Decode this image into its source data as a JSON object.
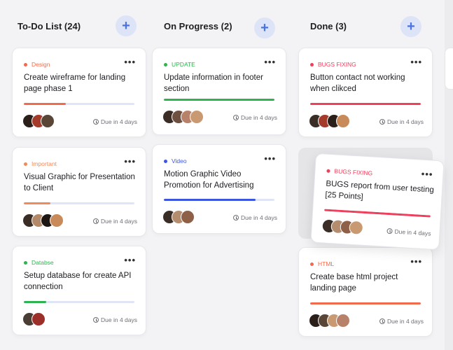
{
  "colors": {
    "design": "#f06a4b",
    "important": "#f08a58",
    "database": "#2fb34f",
    "update": "#2fb34f",
    "video": "#3b55e0",
    "bugs": "#ef3f5b",
    "html": "#f06a4b",
    "add_button": "#dde4f7"
  },
  "columns": [
    {
      "title": "To-Do List (24)",
      "add_icon": "plus-icon",
      "cards": [
        {
          "tag": "Design",
          "tag_color": "#f06a4b",
          "title": "Create wireframe for landing page phase 1",
          "progress": 0.38,
          "bar_color": "#f06a4b",
          "avatars": [
            "#2b1f1a",
            "#a33a2a",
            "#5a4636"
          ],
          "due": "Due in 4 days",
          "more": "•••"
        },
        {
          "tag": "Important",
          "tag_color": "#f08a58",
          "title": "Visual Graphic for Presentation to Client",
          "progress": 0.24,
          "bar_color": "#f08a58",
          "avatars": [
            "#3a2d26",
            "#b28a6a",
            "#1d1612",
            "#c98a5a"
          ],
          "due": "Due in 4 days",
          "more": "•••"
        },
        {
          "tag": "Databse",
          "tag_color": "#2fb34f",
          "title": "Setup database for create API connection",
          "progress": 0.2,
          "bar_color": "#2fb34f",
          "avatars": [
            "#4a3d34",
            "#9c2f2a"
          ],
          "due": "Due in 4 days",
          "more": "•••"
        }
      ]
    },
    {
      "title": "On Progress (2)",
      "add_icon": "plus-icon",
      "cards": [
        {
          "tag": "UPDATE",
          "tag_color": "#2fb34f",
          "title": "Update information in footer section",
          "progress": 1.0,
          "bar_color": "#2fb34f",
          "avatars": [
            "#3a2d26",
            "#6d5040",
            "#b8826a",
            "#c99a72"
          ],
          "due": "Due in 4 days",
          "more": "•••"
        },
        {
          "tag": "Video",
          "tag_color": "#3b55e0",
          "title": "Motion Graphic Video Promotion for Advertising",
          "progress": 0.83,
          "bar_color": "#3b55e0",
          "avatars": [
            "#3a2d26",
            "#b48c6e",
            "#8e6048"
          ],
          "due": "Due in 4 days",
          "more": "•••"
        }
      ]
    },
    {
      "title": "Done (3)",
      "add_icon": "plus-icon",
      "cards": [
        {
          "tag": "BUGS FIXING",
          "tag_color": "#ef3f5b",
          "title": "Button contact not working when clikced",
          "progress": 1.0,
          "bar_color": "#ef3f5b",
          "avatars": [
            "#3a2d26",
            "#a33a2a",
            "#2b1f1a",
            "#c98a5a"
          ],
          "due": "Due in 4 days",
          "more": "•••"
        },
        {
          "tag": "HTML",
          "tag_color": "#f06a4b",
          "title": "Create base html project landing page",
          "progress": 1.0,
          "bar_color": "#f06a4b",
          "avatars": [
            "#2b1f1a",
            "#5a4636",
            "#c99a72",
            "#b8826a"
          ],
          "due": "Due in 4 days",
          "more": "•••"
        }
      ]
    }
  ],
  "dragging_card": {
    "tag": "BUGS FIXING",
    "tag_color": "#ef3f5b",
    "title": "BUGS report from user testing [25 Points]",
    "progress": 1.0,
    "bar_color": "#ef3f5b",
    "avatars": [
      "#3a2d26",
      "#b48c6e",
      "#8e6048",
      "#c99a72"
    ],
    "due": "Due in 4 days",
    "more": "•••"
  }
}
